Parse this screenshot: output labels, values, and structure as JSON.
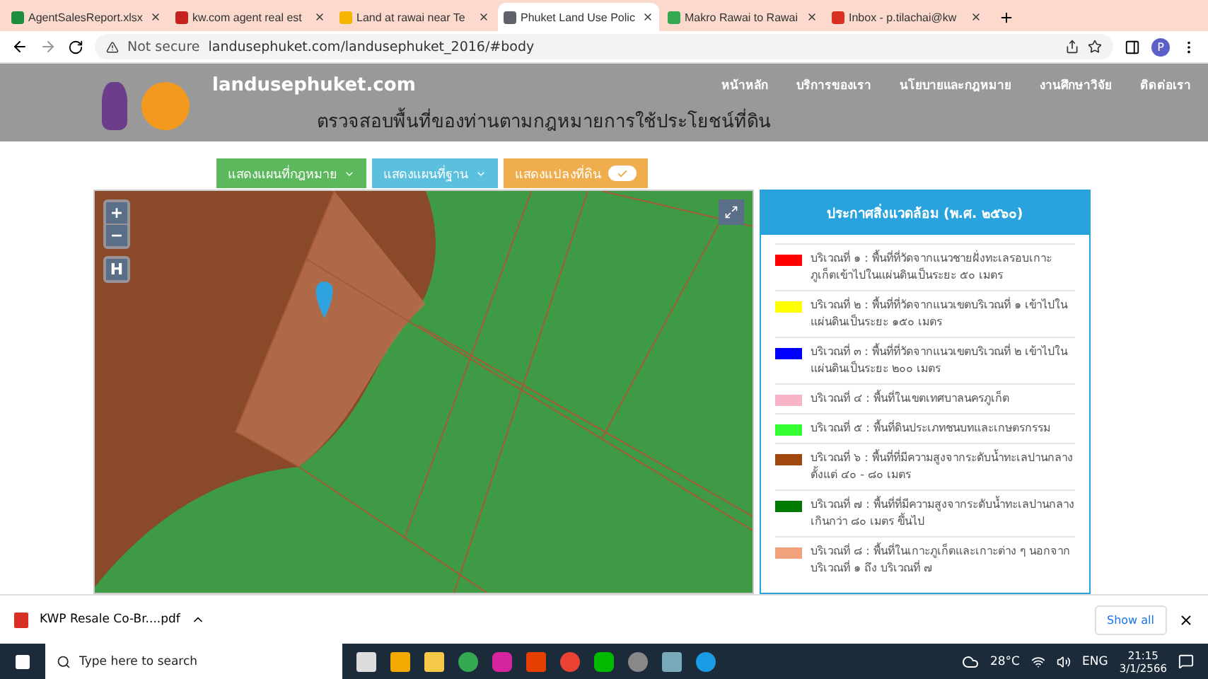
{
  "browser": {
    "tabs": [
      {
        "title": "AgentSalesReport.xlsx",
        "color": "#1e8e3e",
        "selected": false
      },
      {
        "title": "kw.com agent real est",
        "color": "#c5221f",
        "selected": false
      },
      {
        "title": "Land at rawai near Te",
        "color": "#f4b400",
        "selected": false
      },
      {
        "title": "Phuket Land Use Polic",
        "color": "#5f6368",
        "selected": true
      },
      {
        "title": "Makro Rawai to Rawai",
        "color": "#34a853",
        "selected": false
      },
      {
        "title": "Inbox - p.tilachai@kw",
        "color": "#d93025",
        "selected": false
      }
    ],
    "address": {
      "security": "Not secure",
      "url": "landusephuket.com/landusephuket_2016/#body"
    },
    "profile": "P"
  },
  "page": {
    "site_name": "landusephuket.com",
    "title": "ตรวจสอบพื้นที่ของท่านตามกฎหมายการใช้ประโยชน์ที่ดิน",
    "nav": [
      "หน้าหลัก",
      "บริการของเรา",
      "นโยบายและกฎหมาย",
      "งานศึกษาวิจัย",
      "ติดต่อเรา"
    ],
    "buttons": [
      {
        "label": "แสดงแผนที่กฎหมาย",
        "kind": "dropdown",
        "color": "#5cb85c"
      },
      {
        "label": "แสดงแผนที่ฐาน",
        "kind": "dropdown",
        "color": "#5bc0de"
      },
      {
        "label": "แสดงแปลงที่ดิน",
        "kind": "toggle",
        "color": "#f0ad4e",
        "on": true
      }
    ],
    "map": {
      "zoom_in": "+",
      "zoom_out": "−",
      "home": "H"
    },
    "legend": {
      "title": "ประกาศสิ่งแวดล้อม (พ.ศ. ๒๕๖๐)",
      "items": [
        {
          "label": "บริเวณที่ ๑ : พื้นที่ที่วัดจากแนวชายฝั่งทะเลรอบเกาะภูเก็ตเข้าไปในแผ่นดินเป็นระยะ ๕๐ เมตร",
          "color": "#ff0000"
        },
        {
          "label": "บริเวณที่ ๒ : พื้นที่ที่วัดจากแนวเขตบริเวณที่ ๑ เข้าไปในแผ่นดินเป็นระยะ ๑๕๐ เมตร",
          "color": "#ffff00"
        },
        {
          "label": "บริเวณที่ ๓ : พื้นที่ที่วัดจากแนวเขตบริเวณที่ ๒ เข้าไปในแผ่นดินเป็นระยะ ๒๐๐ เมตร",
          "color": "#0000ff"
        },
        {
          "label": "บริเวณที่ ๔ : พื้นที่ในเขตเทศบาลนครภูเก็ต",
          "color": "#f9b4c8"
        },
        {
          "label": "บริเวณที่ ๕ : พื้นที่ดินประเภทชนบทและเกษตรกรรม",
          "color": "#33ff33"
        },
        {
          "label": "บริเวณที่ ๖ : พื้นที่ที่มีความสูงจากระดับน้ำทะเลปานกลางตั้งแต่ ๔๐ - ๘๐ เมตร",
          "color": "#a0470f"
        },
        {
          "label": "บริเวณที่ ๗ : พื้นที่ที่มีความสูงจากระดับน้ำทะเลปานกลางเกินกว่า ๘๐ เมตร ขึ้นไป",
          "color": "#007a00"
        },
        {
          "label": "บริเวณที่ ๘ : พื้นที่ในเกาะภูเก็ตและเกาะต่าง ๆ นอกจากบริเวณที่ ๑ ถึง บริเวณที่ ๗",
          "color": "#f0a27a"
        }
      ]
    }
  },
  "downloads": {
    "file": "KWP Resale Co-Br....pdf",
    "show_all": "Show all"
  },
  "taskbar": {
    "search": "Type here to search",
    "temperature": "28°C",
    "lang": "ENG",
    "time": "21:15",
    "date": "3/1/2566"
  }
}
